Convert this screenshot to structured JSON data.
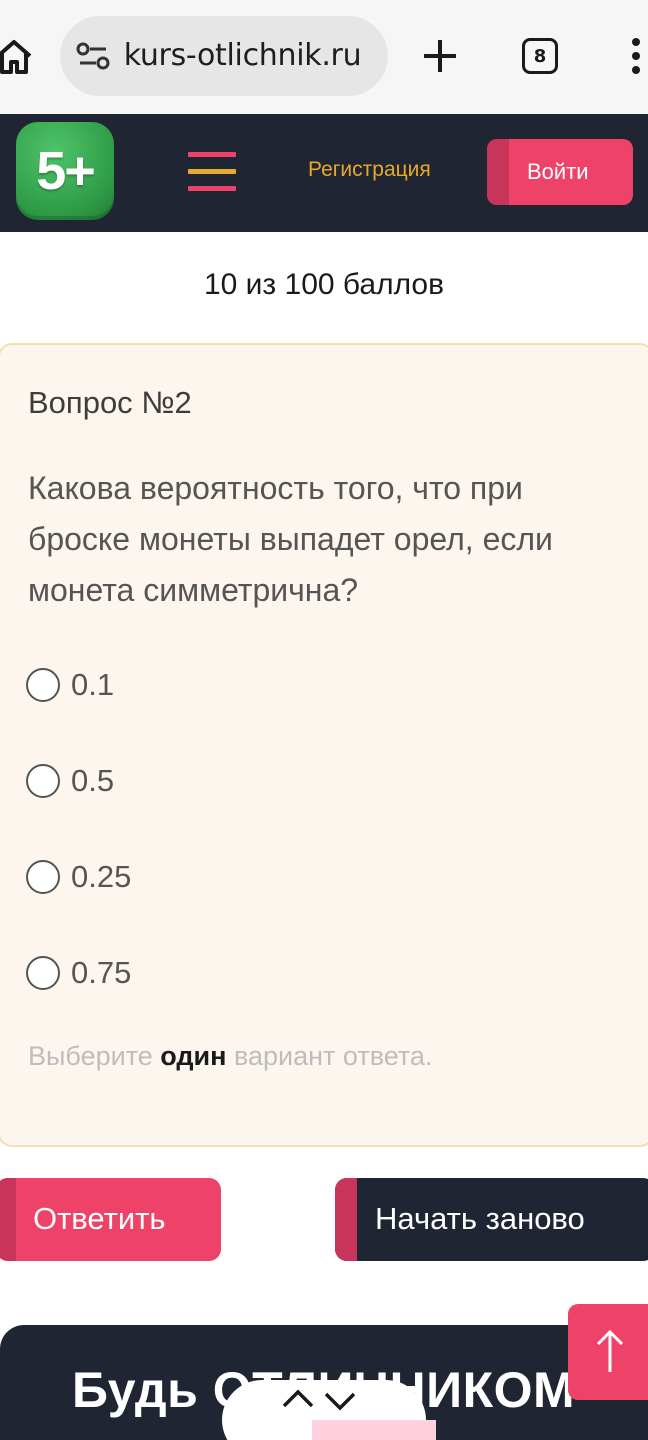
{
  "browser": {
    "url_text": " kurs-otlichnik.ru",
    "tab_count": "8"
  },
  "header": {
    "logo_text": "5+",
    "register_label": "Регистрация",
    "login_label": "Войти",
    "colors": {
      "bg": "#1f2533",
      "accent": "#ef4268",
      "register": "#e7a92a"
    }
  },
  "score_text": "10 из 100 баллов",
  "question": {
    "title": "Вопрос №2",
    "text": "Какова вероятность того, что при броске монеты выпадет орел, если монета симметрична?",
    "options": [
      "0.1",
      "0.5",
      "0.25",
      "0.75"
    ],
    "hint_before": "Выберите ",
    "hint_bold": "один",
    "hint_after": " вариант ответа."
  },
  "actions": {
    "answer_label": "Ответить",
    "restart_label": "Начать заново"
  },
  "promo": {
    "text": "Будь ОТЛИЧНИКОМ"
  }
}
